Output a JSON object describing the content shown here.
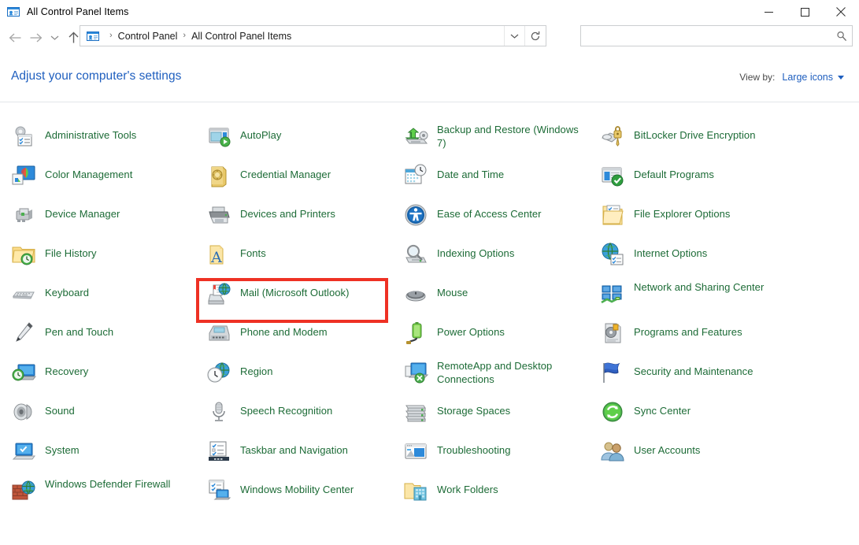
{
  "window": {
    "title": "All Control Panel Items",
    "title_icon": "control-panel-icon",
    "controls": {
      "minimize": "minimize-button",
      "maximize": "maximize-button",
      "close": "close-button"
    }
  },
  "navigation": {
    "back": "back-arrow",
    "forward": "forward-arrow",
    "recent": "recent-locations-chevron",
    "up": "up-arrow",
    "breadcrumb": {
      "icon": "control-panel-icon",
      "items": [
        "Control Panel",
        "All Control Panel Items"
      ],
      "separator": "›"
    },
    "address_dropdown": "chevron-down-icon",
    "refresh": "refresh-icon"
  },
  "search": {
    "value": "",
    "placeholder": "",
    "icon": "search-icon"
  },
  "header": {
    "title": "Adjust your computer's settings",
    "view_by_label": "View by:",
    "view_by_value": "Large icons",
    "view_by_caret": "caret-down-icon"
  },
  "colors": {
    "link_blue": "#1f5fbf",
    "item_green": "#1c6b36",
    "highlight_red": "#ee3124",
    "border_grey": "#ccced0"
  },
  "highlight": {
    "target": "Mail (Microsoft Outlook)",
    "color": "#ee3124"
  },
  "items": [
    {
      "label": "Administrative Tools",
      "icon": "administrative-tools-icon",
      "col": 0,
      "row": 0,
      "lines": 1
    },
    {
      "label": "Color Management",
      "icon": "color-management-icon",
      "col": 0,
      "row": 1,
      "lines": 1
    },
    {
      "label": "Device Manager",
      "icon": "device-manager-icon",
      "col": 0,
      "row": 2,
      "lines": 1
    },
    {
      "label": "File History",
      "icon": "file-history-icon",
      "col": 0,
      "row": 3,
      "lines": 1
    },
    {
      "label": "Keyboard",
      "icon": "keyboard-icon",
      "col": 0,
      "row": 4,
      "lines": 1
    },
    {
      "label": "Pen and Touch",
      "icon": "pen-and-touch-icon",
      "col": 0,
      "row": 5,
      "lines": 1
    },
    {
      "label": "Recovery",
      "icon": "recovery-icon",
      "col": 0,
      "row": 6,
      "lines": 1
    },
    {
      "label": "Sound",
      "icon": "sound-icon",
      "col": 0,
      "row": 7,
      "lines": 1
    },
    {
      "label": "System",
      "icon": "system-icon",
      "col": 0,
      "row": 8,
      "lines": 1
    },
    {
      "label": "Windows Defender Firewall",
      "icon": "windows-defender-firewall-icon",
      "col": 0,
      "row": 9,
      "lines": 2
    },
    {
      "label": "AutoPlay",
      "icon": "autoplay-icon",
      "col": 1,
      "row": 0,
      "lines": 1
    },
    {
      "label": "Credential Manager",
      "icon": "credential-manager-icon",
      "col": 1,
      "row": 1,
      "lines": 1
    },
    {
      "label": "Devices and Printers",
      "icon": "devices-and-printers-icon",
      "col": 1,
      "row": 2,
      "lines": 1
    },
    {
      "label": "Fonts",
      "icon": "fonts-icon",
      "col": 1,
      "row": 3,
      "lines": 1
    },
    {
      "label": "Mail (Microsoft Outlook)",
      "icon": "mail-icon",
      "col": 1,
      "row": 4,
      "lines": 1
    },
    {
      "label": "Phone and Modem",
      "icon": "phone-and-modem-icon",
      "col": 1,
      "row": 5,
      "lines": 1
    },
    {
      "label": "Region",
      "icon": "region-icon",
      "col": 1,
      "row": 6,
      "lines": 1
    },
    {
      "label": "Speech Recognition",
      "icon": "speech-recognition-icon",
      "col": 1,
      "row": 7,
      "lines": 1
    },
    {
      "label": "Taskbar and Navigation",
      "icon": "taskbar-and-navigation-icon",
      "col": 1,
      "row": 8,
      "lines": 1
    },
    {
      "label": "Windows Mobility Center",
      "icon": "windows-mobility-center-icon",
      "col": 1,
      "row": 9,
      "lines": 1
    },
    {
      "label": "Backup and Restore (Windows 7)",
      "icon": "backup-and-restore-icon",
      "col": 2,
      "row": 0,
      "lines": 2
    },
    {
      "label": "Date and Time",
      "icon": "date-and-time-icon",
      "col": 2,
      "row": 1,
      "lines": 1
    },
    {
      "label": "Ease of Access Center",
      "icon": "ease-of-access-icon",
      "col": 2,
      "row": 2,
      "lines": 1
    },
    {
      "label": "Indexing Options",
      "icon": "indexing-options-icon",
      "col": 2,
      "row": 3,
      "lines": 1
    },
    {
      "label": "Mouse",
      "icon": "mouse-icon",
      "col": 2,
      "row": 4,
      "lines": 1
    },
    {
      "label": "Power Options",
      "icon": "power-options-icon",
      "col": 2,
      "row": 5,
      "lines": 1
    },
    {
      "label": "RemoteApp and Desktop Connections",
      "icon": "remoteapp-icon",
      "col": 2,
      "row": 6,
      "lines": 2
    },
    {
      "label": "Storage Spaces",
      "icon": "storage-spaces-icon",
      "col": 2,
      "row": 7,
      "lines": 1
    },
    {
      "label": "Troubleshooting",
      "icon": "troubleshooting-icon",
      "col": 2,
      "row": 8,
      "lines": 1
    },
    {
      "label": "Work Folders",
      "icon": "work-folders-icon",
      "col": 2,
      "row": 9,
      "lines": 1
    },
    {
      "label": "BitLocker Drive Encryption",
      "icon": "bitlocker-icon",
      "col": 3,
      "row": 0,
      "lines": 1
    },
    {
      "label": "Default Programs",
      "icon": "default-programs-icon",
      "col": 3,
      "row": 1,
      "lines": 1
    },
    {
      "label": "File Explorer Options",
      "icon": "file-explorer-options-icon",
      "col": 3,
      "row": 2,
      "lines": 1
    },
    {
      "label": "Internet Options",
      "icon": "internet-options-icon",
      "col": 3,
      "row": 3,
      "lines": 1
    },
    {
      "label": "Network and Sharing Center",
      "icon": "network-and-sharing-icon",
      "col": 3,
      "row": 4,
      "lines": 2
    },
    {
      "label": "Programs and Features",
      "icon": "programs-and-features-icon",
      "col": 3,
      "row": 5,
      "lines": 1
    },
    {
      "label": "Security and Maintenance",
      "icon": "security-and-maintenance-icon",
      "col": 3,
      "row": 6,
      "lines": 1
    },
    {
      "label": "Sync Center",
      "icon": "sync-center-icon",
      "col": 3,
      "row": 7,
      "lines": 1
    },
    {
      "label": "User Accounts",
      "icon": "user-accounts-icon",
      "col": 3,
      "row": 8,
      "lines": 1
    }
  ]
}
